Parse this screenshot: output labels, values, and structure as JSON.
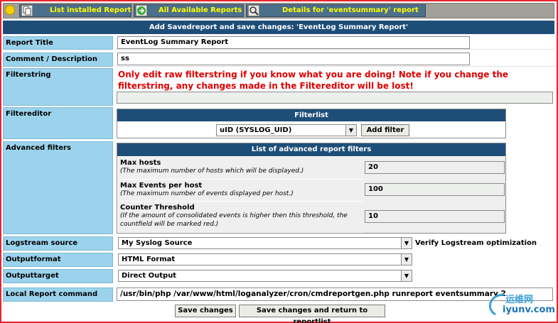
{
  "toolbar": {
    "items": [
      {
        "label": "List installed Reports",
        "icon": "report-list-icon"
      },
      {
        "label": "All Available Reports",
        "icon": "arrow-icon"
      },
      {
        "label": "Details for 'eventsummary' report",
        "icon": "search-icon"
      }
    ]
  },
  "header": {
    "title": "Add Savedreport and save changes: 'EventLog Summary Report'"
  },
  "form": {
    "report_title": {
      "label": "Report Title",
      "value": "EventLog Summary Report"
    },
    "comment": {
      "label": "Comment / Description",
      "value": "ss"
    },
    "filterstring": {
      "label": "Filterstring",
      "warning": "Only edit raw filterstring if you know what you are doing! Note if you change the filterstring, any changes made in the Filtereditor will be lost!",
      "value": ""
    },
    "filtereditor": {
      "label": "Filtereditor",
      "list_title": "Filterlist",
      "selected": "uID (SYSLOG_UID)",
      "add_button": "Add filter"
    },
    "advanced": {
      "label": "Advanced filters",
      "list_title": "List of advanced report filters",
      "rows": [
        {
          "title": "Max hosts",
          "desc": "(The maximum number of hosts which will be displayed.)",
          "value": "20"
        },
        {
          "title": "Max Events per host",
          "desc": "(The maximum number of events displayed per host.)",
          "value": "100"
        },
        {
          "title": "Counter Threshold",
          "desc": "(If the amount of consolidated events is higher then this threshold, the countfield will be marked red.)",
          "value": "10"
        }
      ]
    },
    "logstream": {
      "label": "Logstream source",
      "selected": "My Syslog Source",
      "verify_text": "Verify Logstream optimization"
    },
    "outputformat": {
      "label": "Outputformat",
      "selected": "HTML Format"
    },
    "outputtarget": {
      "label": "Outputtarget",
      "selected": "Direct Output"
    },
    "local_command": {
      "label": "Local Report command",
      "value": "/usr/bin/php /var/www/html/loganalyzer/cron/cmdreportgen.php runreport eventsummary 2"
    }
  },
  "buttons": {
    "save": "Save changes",
    "save_return": "Save changes and return to reportlist"
  },
  "watermark": {
    "cn": "运维网",
    "domain": "iyunv.com"
  }
}
